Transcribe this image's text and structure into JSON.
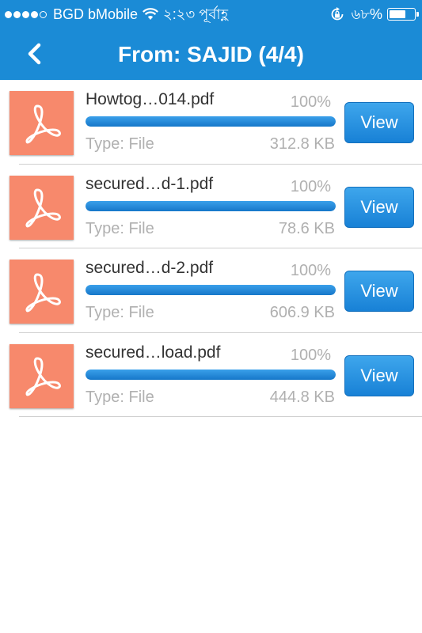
{
  "status_bar": {
    "carrier": "BGD bMobile",
    "time": "২:২৩ পূর্বাহ্ণ",
    "battery": "৬৮%",
    "signal_bars_filled": 4,
    "signal_bars_total": 5,
    "battery_level": 0.68
  },
  "nav": {
    "title": "From: SAJID (4/4)",
    "back_icon": "chevron-left-icon"
  },
  "colors": {
    "header": "#1b8bd6",
    "thumbnail": "#f7896c",
    "progress": "#1b8bd6"
  },
  "files": [
    {
      "name": "Howtog…014.pdf",
      "percent": "100%",
      "progress": 1.0,
      "type": "Type: File",
      "size": "312.8 KB",
      "action": "View",
      "icon": "pdf-icon"
    },
    {
      "name": "secured…d-1.pdf",
      "percent": "100%",
      "progress": 1.0,
      "type": "Type: File",
      "size": "78.6 KB",
      "action": "View",
      "icon": "pdf-icon"
    },
    {
      "name": "secured…d-2.pdf",
      "percent": "100%",
      "progress": 1.0,
      "type": "Type: File",
      "size": "606.9 KB",
      "action": "View",
      "icon": "pdf-icon"
    },
    {
      "name": "secured…load.pdf",
      "percent": "100%",
      "progress": 1.0,
      "type": "Type: File",
      "size": "444.8 KB",
      "action": "View",
      "icon": "pdf-icon"
    }
  ]
}
